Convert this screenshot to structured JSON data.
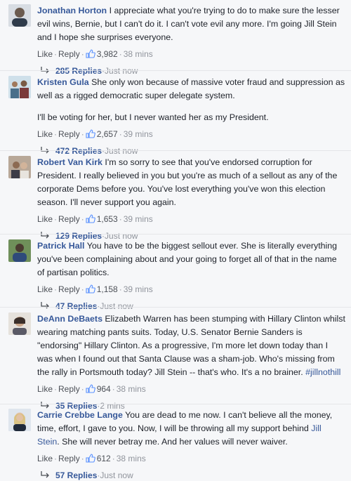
{
  "ui": {
    "like": "Like",
    "reply": "Reply",
    "dot": "·"
  },
  "comments": [
    {
      "author": "Jonathan Horton",
      "text": "I appreciate what you're trying to do to make sure the lesser evil wins, Bernie, but I can't do it. I can't vote evil any more. I'm going Jill Stein and I hope she surprises everyone.",
      "likes": "3,982",
      "time": "38 mins",
      "replies": "285 Replies",
      "reply_time": "Just now"
    },
    {
      "author": "Kristen Gula",
      "text": "She only won because of massive voter fraud and suppression as well as a rigged democratic super delegate system.",
      "text2": "I'll be voting for her, but I never wanted her as my President.",
      "likes": "2,657",
      "time": "39 mins",
      "replies": "472 Replies",
      "reply_time": "Just now"
    },
    {
      "author": "Robert Van Kirk",
      "text": "I'm so sorry to see that you've endorsed corruption for President. I really believed in you but you're as much of a sellout as any of the corporate Dems before you. You've lost everything you've won this election season. I'll never support you again.",
      "likes": "1,653",
      "time": "39 mins",
      "replies": "129 Replies",
      "reply_time": "Just now"
    },
    {
      "author": "Patrick Hall",
      "text": "You have to be the biggest sellout ever. She is literally everything you've been complaining about and your going to forget all of that in the name of partisan politics.",
      "likes": "1,158",
      "time": "39 mins",
      "replies": "47 Replies",
      "reply_time": "Just now"
    },
    {
      "author": "DeAnn DeBaets",
      "text": "Elizabeth Warren has been stumping with Hillary Clinton whilst wearing matching pants suits. Today, U.S. Senator Bernie Sanders is \"endorsing\" Hillary Clinton. As a progressive, I'm more let down today than I was when I found out that Santa Clause was a sham-job. Who's missing from the rally in Portsmouth today? Jill Stein -- that's who. It's a no brainer. ",
      "tag": "#jillnothill",
      "likes": "964",
      "time": "38 mins",
      "replies": "35 Replies",
      "reply_time": "2 mins"
    },
    {
      "author": "Carrie Crebbe Lange",
      "text": "You are dead to me now. I can't believe all the money, time, effort, I gave to you. Now, I will be throwing all my support behind ",
      "tag": "Jill Stein",
      "text_after": ". She will never betray me. And her values will never waiver.",
      "likes": "612",
      "time": "38 mins",
      "replies": "57 Replies",
      "reply_time": "Just now"
    }
  ]
}
